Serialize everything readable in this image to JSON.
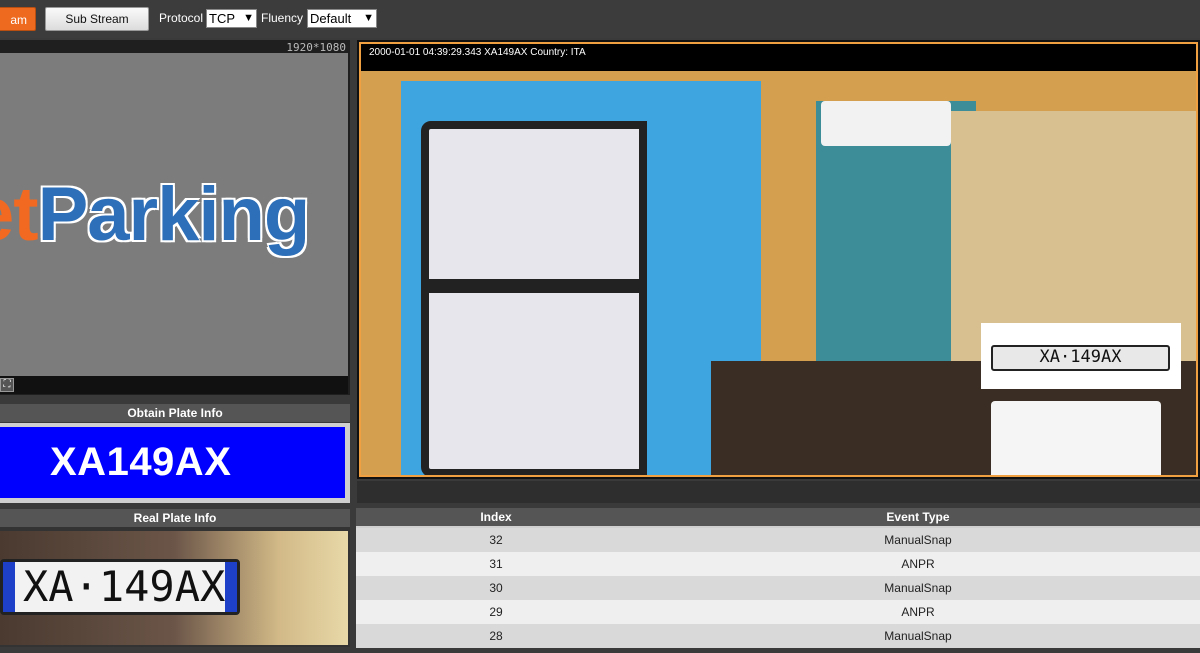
{
  "toolbar": {
    "main_stream_label": "am",
    "sub_stream_label": "Sub Stream",
    "protocol_label": "Protocol",
    "protocol_value": "TCP",
    "fluency_label": "Fluency",
    "fluency_value": "Default"
  },
  "preview": {
    "resolution": "1920*1080",
    "logo_part1": "et",
    "logo_part2": "Parking"
  },
  "obtain_plate": {
    "title": "Obtain Plate Info",
    "plate": "XA149AX"
  },
  "real_plate": {
    "title": "Real Plate Info",
    "plate_text": "XA·149AX"
  },
  "camera": {
    "osd": "2000-01-01 04:39:29.343 XA149AX Country: ITA",
    "plate_text": "XA·149AX"
  },
  "events": {
    "headers": {
      "index": "Index",
      "event_type": "Event Type"
    },
    "rows": [
      {
        "index": "32",
        "type": "ManualSnap"
      },
      {
        "index": "31",
        "type": "ANPR"
      },
      {
        "index": "30",
        "type": "ManualSnap"
      },
      {
        "index": "29",
        "type": "ANPR"
      },
      {
        "index": "28",
        "type": "ManualSnap"
      }
    ]
  },
  "colors": {
    "accent": "#ee6a1f",
    "plate_blue": "#0000ff",
    "highlight_border": "#f0a040"
  }
}
